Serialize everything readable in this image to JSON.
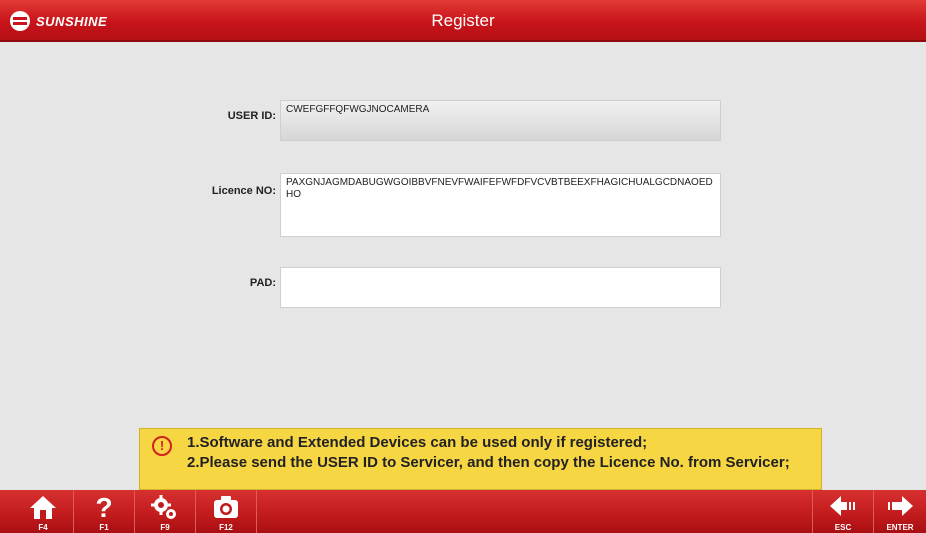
{
  "header": {
    "brand": "SUNSHINE",
    "title": "Register"
  },
  "form": {
    "user_id": {
      "label": "USER ID:",
      "value": "CWEFGFFQFWGJNOCAMERA"
    },
    "licence": {
      "label": "Licence NO:",
      "value": "PAXGNJAGMDABUGWGOIBBVFNEVFWAIFEFWFDFVCVBTBEEXFHAGICHUALGCDNAOEDHO"
    },
    "pad": {
      "label": "PAD:",
      "value": ""
    }
  },
  "notice": {
    "icon": "warning-icon",
    "line1": "1.Software and Extended Devices can be used only if registered;",
    "line2": "2.Please send the USER ID to Servicer, and then copy the Licence No. from Servicer;"
  },
  "toolbar": {
    "home": {
      "icon": "home-icon",
      "key": "F4"
    },
    "help": {
      "icon": "help-icon",
      "key": "F1"
    },
    "settings": {
      "icon": "gears-icon",
      "key": "F9"
    },
    "screenshot": {
      "icon": "camera-icon",
      "key": "F12"
    },
    "back": {
      "icon": "back-arrow-icon",
      "key": "ESC"
    },
    "enter": {
      "icon": "forward-arrow-icon",
      "key": "ENTER"
    }
  },
  "colors": {
    "brand_red": "#c8141a",
    "notice_yellow": "#f7d644"
  }
}
